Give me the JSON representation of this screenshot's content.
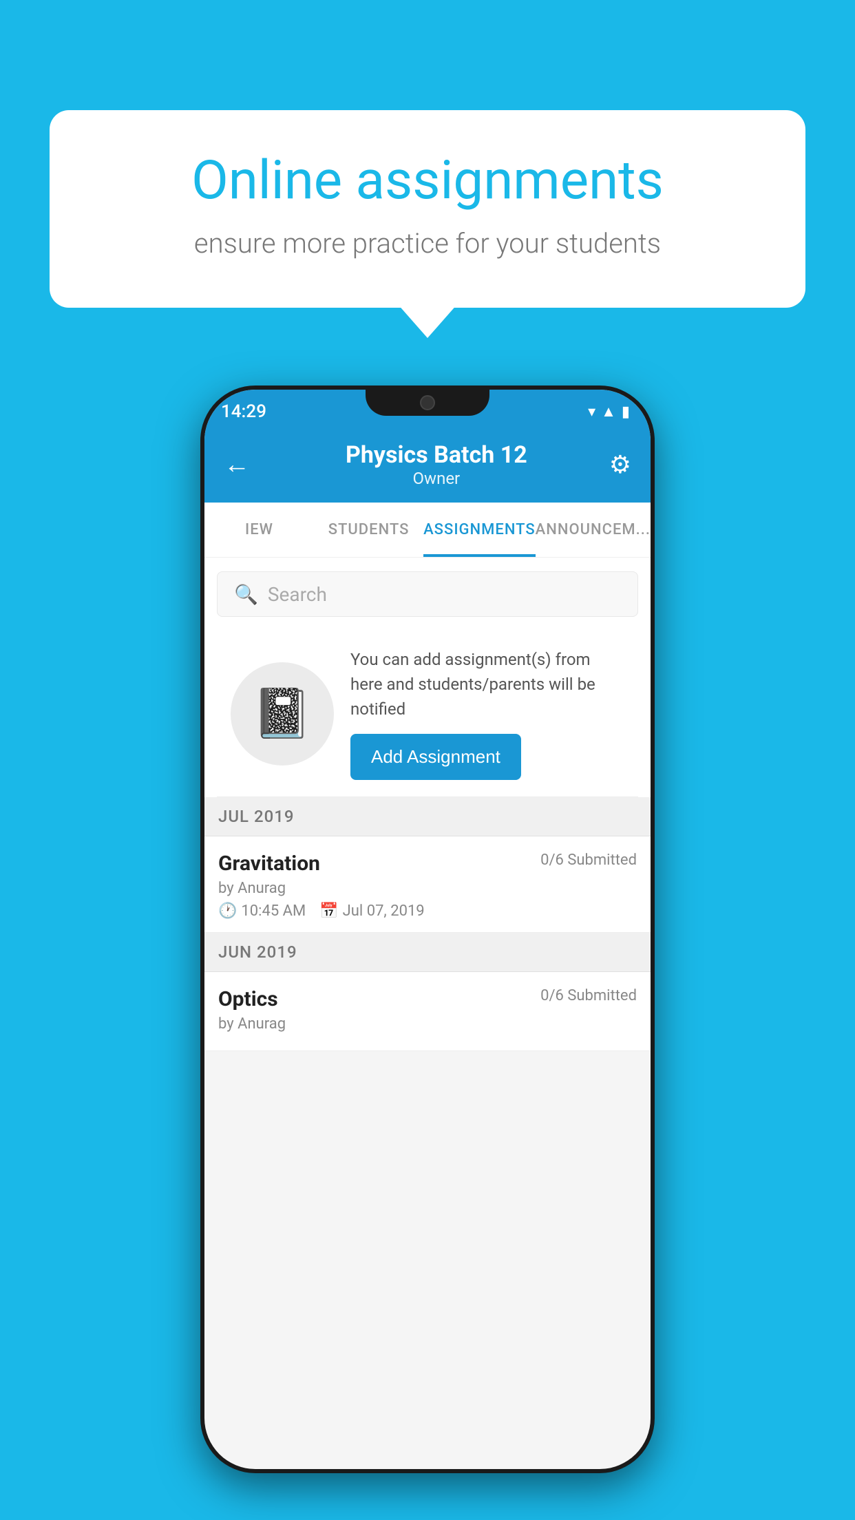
{
  "background_color": "#1ab8e8",
  "speech_bubble": {
    "title": "Online assignments",
    "subtitle": "ensure more practice for your students"
  },
  "status_bar": {
    "time": "14:29",
    "wifi_icon": "wifi",
    "signal_icon": "signal",
    "battery_icon": "battery"
  },
  "app_bar": {
    "title": "Physics Batch 12",
    "subtitle": "Owner",
    "back_label": "back",
    "settings_label": "settings"
  },
  "tabs": [
    {
      "label": "IEW",
      "active": false
    },
    {
      "label": "STUDENTS",
      "active": false
    },
    {
      "label": "ASSIGNMENTS",
      "active": true
    },
    {
      "label": "ANNOUNCEM...",
      "active": false
    }
  ],
  "search": {
    "placeholder": "Search"
  },
  "promo": {
    "text": "You can add assignment(s) from here and students/parents will be notified",
    "button_label": "Add Assignment"
  },
  "sections": [
    {
      "month": "JUL 2019",
      "assignments": [
        {
          "title": "Gravitation",
          "submitted": "0/6 Submitted",
          "by": "by Anurag",
          "time": "10:45 AM",
          "date": "Jul 07, 2019"
        }
      ]
    },
    {
      "month": "JUN 2019",
      "assignments": [
        {
          "title": "Optics",
          "submitted": "0/6 Submitted",
          "by": "by Anurag",
          "time": "",
          "date": ""
        }
      ]
    }
  ]
}
